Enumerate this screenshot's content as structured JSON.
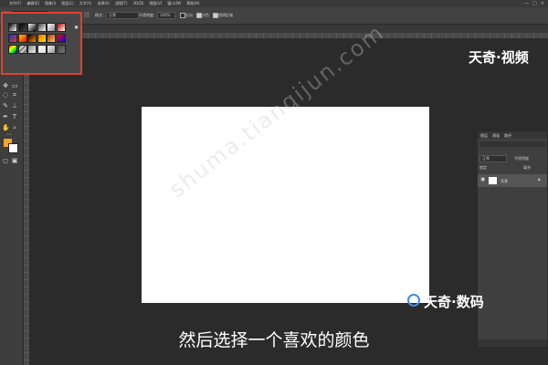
{
  "menu": {
    "items": [
      "文件(F)",
      "编辑(E)",
      "图像(I)",
      "图层(L)",
      "文字(Y)",
      "选择(S)",
      "滤镜(T)",
      "3D(D)",
      "视图(V)",
      "窗口(W)",
      "帮助(H)"
    ]
  },
  "window_controls": [
    "—",
    "□",
    "×"
  ],
  "options": {
    "mode_label": "模式:",
    "mode_value": "正常",
    "opacity_label": "不透明度:",
    "opacity_value": "100%",
    "reverse_label": "反向",
    "dither_label": "仿色",
    "transparency_label": "透明区域"
  },
  "layers_panel": {
    "tabs": [
      "图层",
      "通道",
      "路径"
    ],
    "mode_value": "正常",
    "opacity_label": "不透明度",
    "lock_label": "锁定",
    "fill_label": "填充",
    "layer_name": "背景"
  },
  "logo_top": "天奇·视频",
  "logo_bottom": "天奇·数码",
  "watermark": "shuma.tianqijun.com",
  "subtitle": "然后选择一个喜欢的颜色",
  "colors": {
    "foreground": "#f5a623",
    "background": "#ffffff",
    "highlight": "#e0412f"
  },
  "icons": [
    "gear-icon",
    "move-icon",
    "marquee-icon",
    "lasso-icon",
    "brush-icon",
    "eraser-icon",
    "gradient-icon",
    "pen-icon",
    "text-icon",
    "hand-icon",
    "zoom-icon",
    "eye-icon",
    "lock-icon"
  ]
}
